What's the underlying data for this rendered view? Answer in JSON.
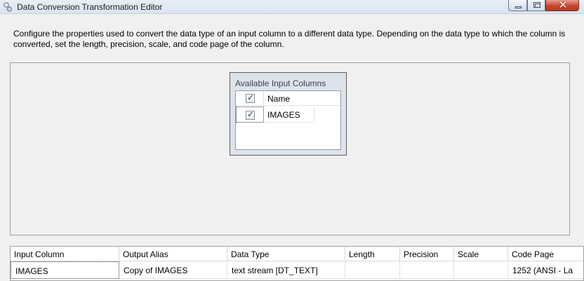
{
  "window": {
    "title": "Data Conversion Transformation Editor"
  },
  "description": "Configure the properties used to convert the data type of an input column to a different data type. Depending on the data type to which the column is converted, set the length, precision, scale, and code page of the column.",
  "input_columns": {
    "title": "Available Input Columns",
    "header": {
      "name_label": "Name",
      "all_checked": true
    },
    "rows": [
      {
        "name": "IMAGES",
        "checked": true
      }
    ]
  },
  "grid": {
    "columns": [
      "Input Column",
      "Output Alias",
      "Data Type",
      "Length",
      "Precision",
      "Scale",
      "Code Page"
    ],
    "rows": [
      [
        "IMAGES",
        "Copy of IMAGES",
        "text stream [DT_TEXT]",
        "",
        "",
        "",
        "1252  (ANSI - La"
      ]
    ]
  },
  "icons": {
    "app": "data-conversion-icon",
    "minimize": "minimize-icon",
    "maximize": "maximize-icon",
    "close": "close-icon"
  },
  "colors": {
    "title_bar": "#dbe4f0",
    "close_button": "#c9472e",
    "panel_background": "#dde3ea"
  }
}
